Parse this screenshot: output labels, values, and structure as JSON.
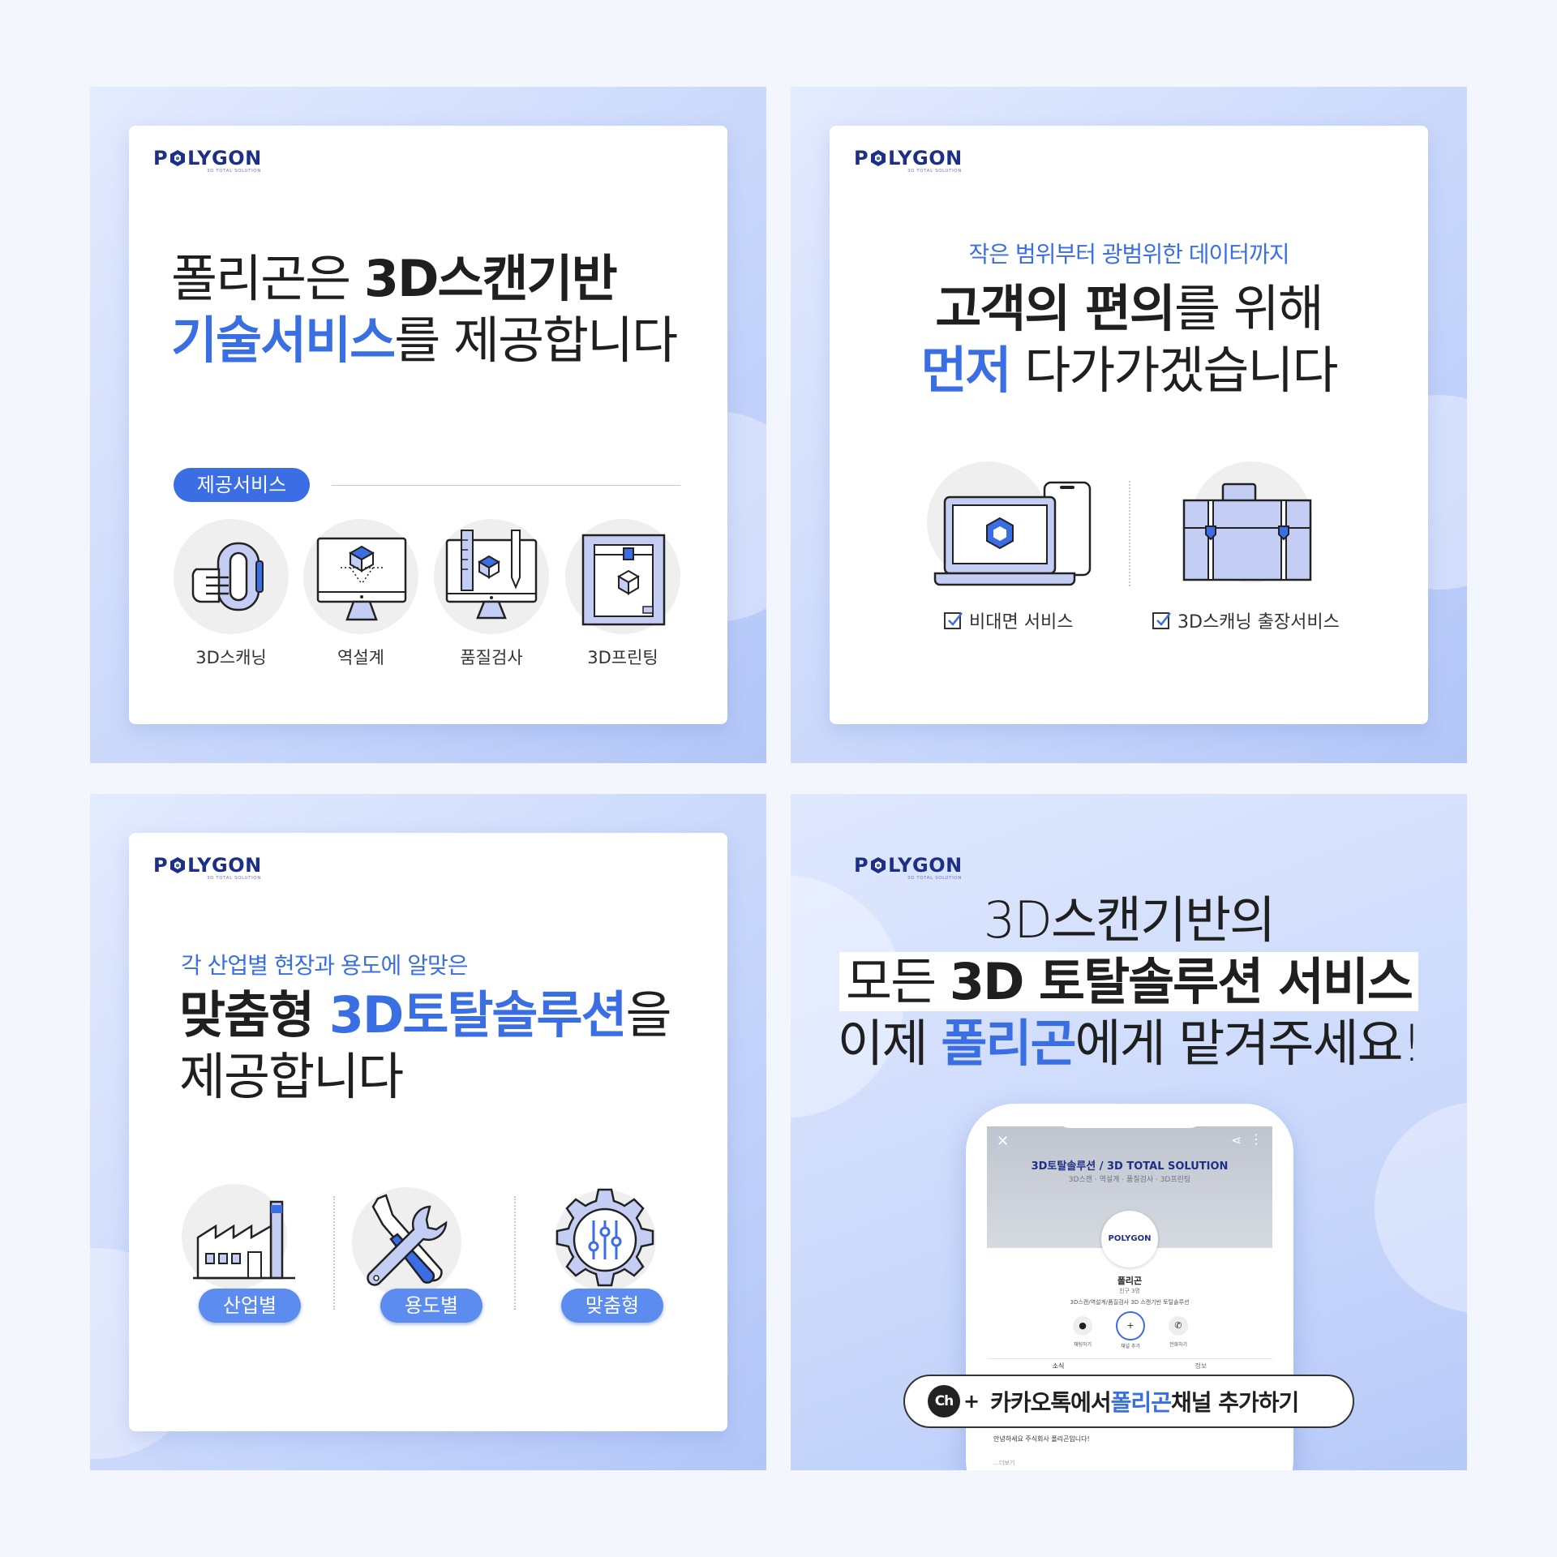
{
  "logo": {
    "text": "POLYGON",
    "letter_before": "P",
    "letters_after": "LYGON",
    "sub": "3D TOTAL SOLUTION"
  },
  "panel1": {
    "line1_a": "폴리곤은 ",
    "line1_b": "3D스캔기반",
    "line2_a": "기술서비스",
    "line2_b": "를 제공합니다",
    "pill": "제공서비스",
    "services": [
      "3D스캐닝",
      "역설계",
      "품질검사",
      "3D프린팅"
    ]
  },
  "panel2": {
    "sub": "작은 범위부터 광범위한 데이터까지",
    "line1_a": "고객의 편의",
    "line1_b": "를 위해",
    "line2_a": "먼저",
    "line2_b": " 다가가겠습니다",
    "items": [
      "비대면 서비스",
      "3D스캐닝 출장서비스"
    ]
  },
  "panel3": {
    "sub": "각 산업별 현장과 용도에 알맞은",
    "line1_a": "맞춤형 ",
    "line1_b": "3D토탈솔루션",
    "line1_c": "을",
    "line2": "제공합니다",
    "pills": [
      "산업별",
      "용도별",
      "맞춤형"
    ]
  },
  "panel4": {
    "line1": "3D스캔기반의",
    "line2_a": "모든 ",
    "line2_b": "3D 토탈솔루션 서비스",
    "line3_a": "이제 ",
    "line3_b": "폴리곤",
    "line3_c": "에게 맡겨주세요!",
    "phone": {
      "banner_title": "3D토탈솔루션 / 3D TOTAL SOLUTION",
      "banner_sub": "3D스캔 · 역설계 · 품질검사 · 3D프린팅",
      "profile_logo": "POLYGON",
      "name": "폴리곤",
      "friends": "친구 3명",
      "desc": "3D스캔/역설계/품질검사 3D 스캔기반 토탈솔루션",
      "actions": [
        "채팅하기",
        "채널 추가",
        "전화하기"
      ],
      "tabs": [
        "소식",
        "정보"
      ],
      "post": "안녕하세요 주식회사 폴리곤입니다!",
      "more": "…더보기"
    },
    "kakao": {
      "badge": "Ch",
      "plus": "+",
      "text_a": "카카오톡에서 ",
      "text_b": "폴리곤",
      "text_c": " 채널 추가하기"
    }
  },
  "colors": {
    "accent": "#3a6ee3",
    "navy": "#1d2f86",
    "panel_bg": "#c9d7fb"
  }
}
